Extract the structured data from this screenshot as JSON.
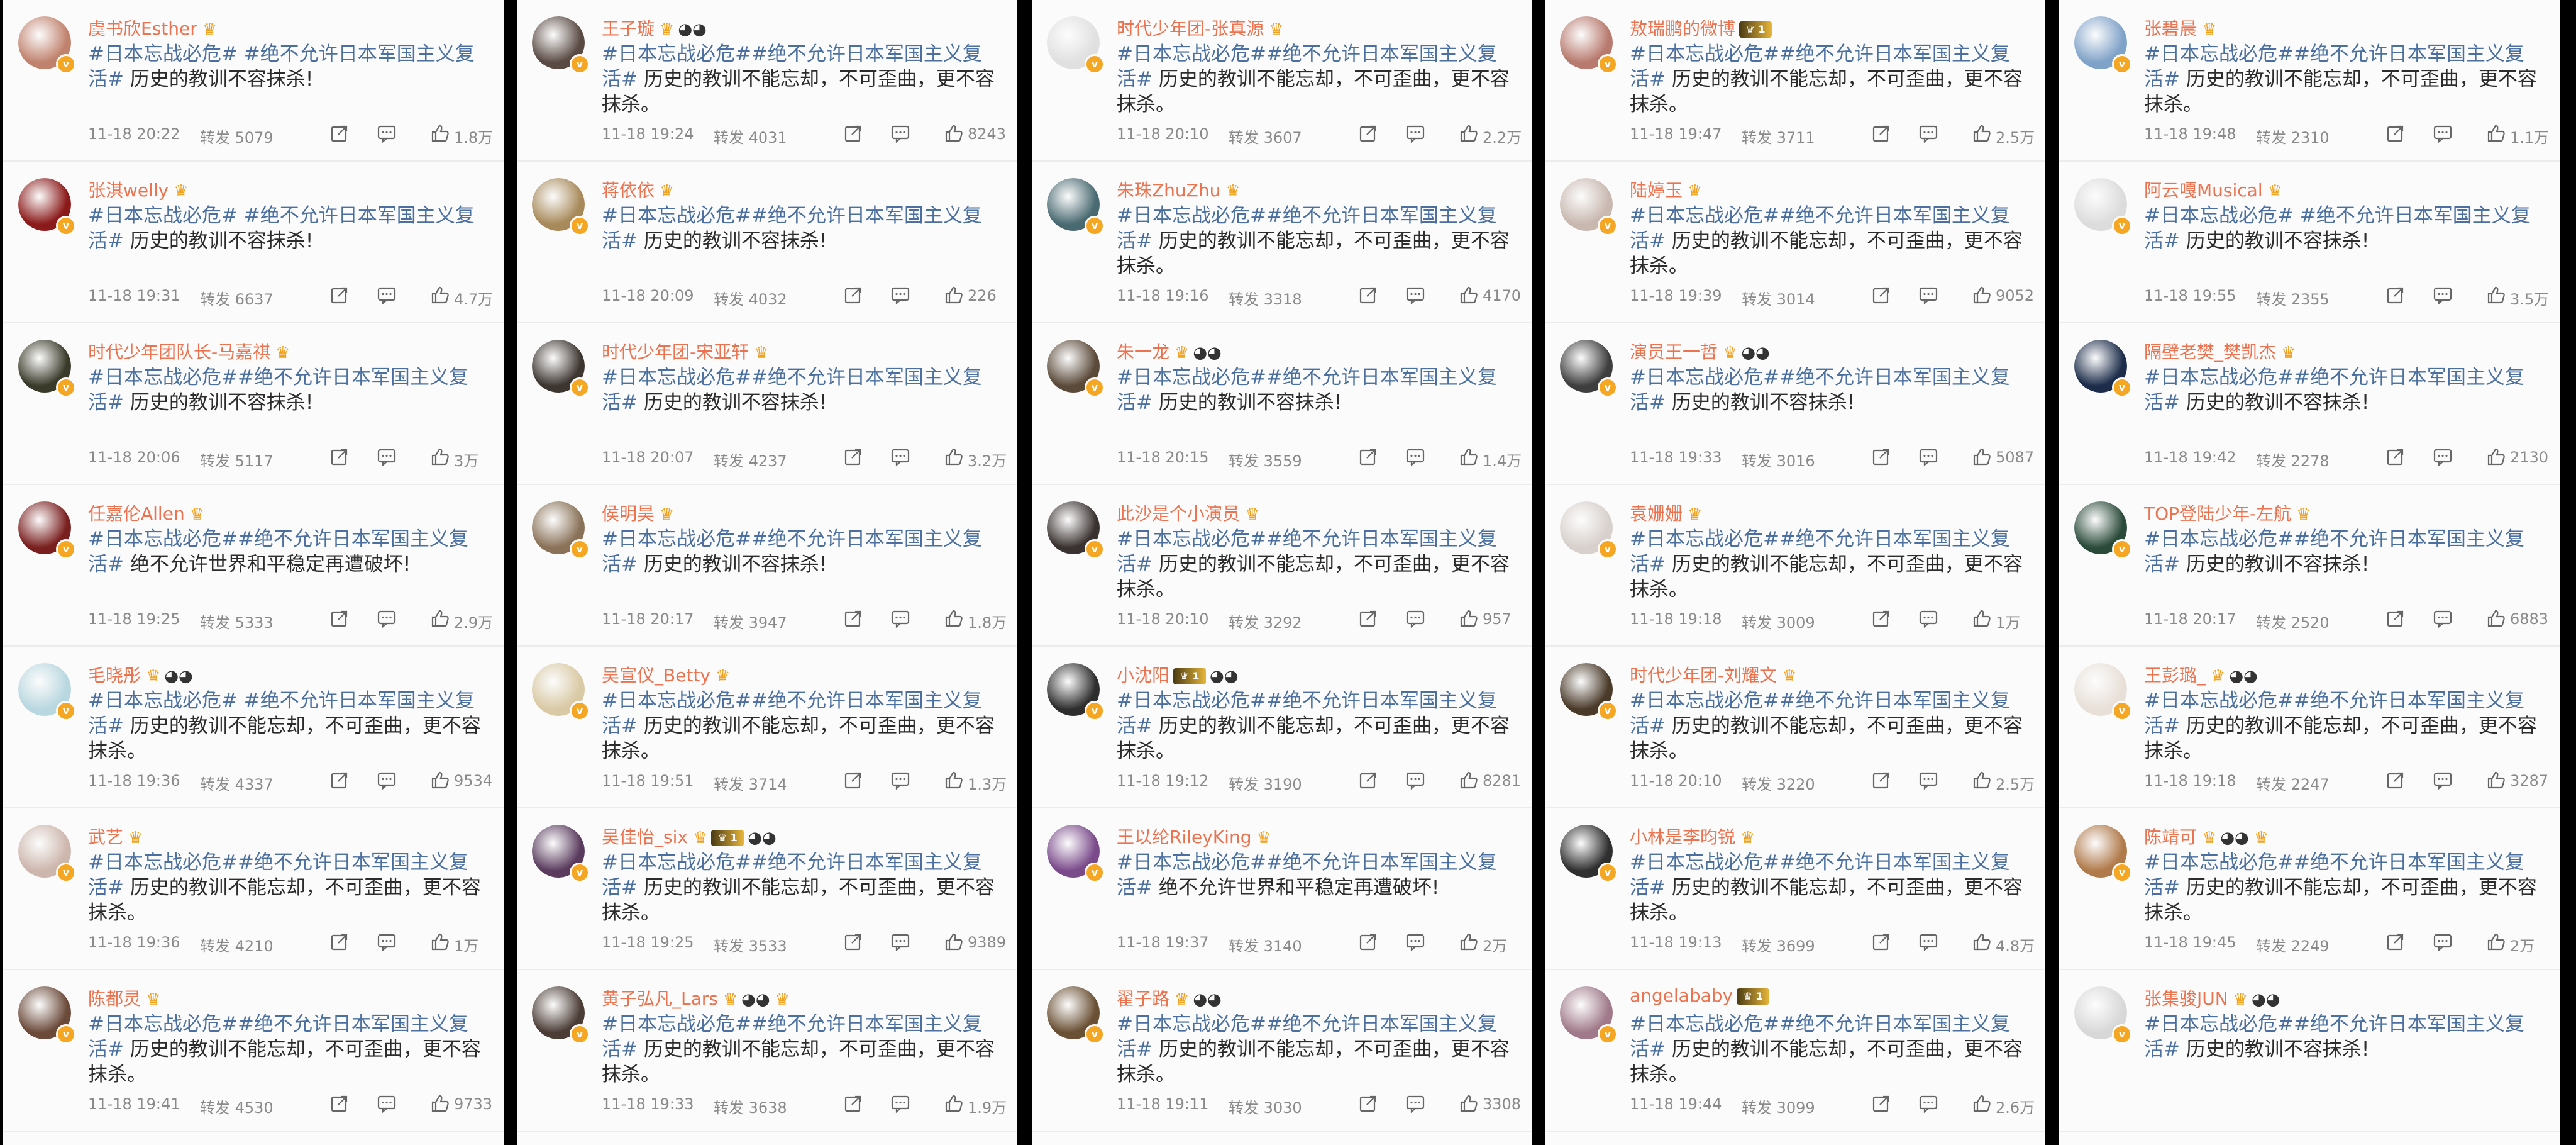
{
  "columns": [
    {
      "posts": [
        {
          "name": "虞书欣Esther",
          "badges": [
            "crown"
          ],
          "tags": "#日本忘战必危# #绝不允许日本军国主义复活#",
          "text": " 历史的教训不容抹杀!",
          "time": "11-18 20:22",
          "repost": "转发 5079",
          "likes": "1.8万",
          "av": "#c0826d"
        },
        {
          "name": "张淇welly",
          "badges": [
            "crown"
          ],
          "tags": "#日本忘战必危# #绝不允许日本军国主义复活#",
          "text": " 历史的教训不容抹杀!",
          "time": "11-18 19:31",
          "repost": "转发 6637",
          "likes": "4.7万",
          "av": "#8b1a1a"
        },
        {
          "name": "时代少年团队长-马嘉祺",
          "badges": [
            "crown"
          ],
          "tags": "#日本忘战必危##绝不允许日本军国主义复活#",
          "text": " 历史的教训不容抹杀!",
          "time": "11-18 20:06",
          "repost": "转发 5117",
          "likes": "3万",
          "av": "#3a3a2a"
        },
        {
          "name": "任嘉伦Allen",
          "badges": [
            "crown"
          ],
          "tags": "#日本忘战必危##绝不允许日本军国主义复活#",
          "text": " 绝不允许世界和平稳定再遭破坏!",
          "time": "11-18 19:25",
          "repost": "转发 5333",
          "likes": "2.9万",
          "av": "#7a1f1f"
        },
        {
          "name": "毛晓彤",
          "badges": [
            "crown",
            "panda"
          ],
          "tags": "#日本忘战必危# #绝不允许日本军国主义复活#",
          "text": " 历史的教训不能忘却，不可歪曲，更不容抹杀。",
          "time": "11-18 19:36",
          "repost": "转发 4337",
          "likes": "9534",
          "av": "#b9d7e0"
        },
        {
          "name": "武艺",
          "badges": [
            "crown"
          ],
          "tags": "#日本忘战必危##绝不允许日本军国主义复活#",
          "text": " 历史的教训不能忘却，不可歪曲，更不容抹杀。",
          "time": "11-18 19:36",
          "repost": "转发 4210",
          "likes": "1万",
          "av": "#cdb6ad"
        },
        {
          "name": "陈都灵",
          "badges": [
            "crown"
          ],
          "tags": "#日本忘战必危##绝不允许日本军国主义复活#",
          "text": " 历史的教训不能忘却，不可歪曲，更不容抹杀。",
          "time": "11-18 19:41",
          "repost": "转发 4530",
          "likes": "9733",
          "av": "#6b4a3a"
        }
      ]
    },
    {
      "posts": [
        {
          "name": "王子璇",
          "badges": [
            "crown",
            "panda"
          ],
          "tags": "#日本忘战必危##绝不允许日本军国主义复活#",
          "text": " 历史的教训不能忘却，不可歪曲，更不容抹杀。",
          "time": "11-18 19:24",
          "repost": "转发 4031",
          "likes": "8243",
          "av": "#5a4a44"
        },
        {
          "name": "蒋依依",
          "badges": [
            "crown"
          ],
          "tags": "#日本忘战必危##绝不允许日本军国主义复活#",
          "text": " 历史的教训不容抹杀!",
          "time": "11-18 20:09",
          "repost": "转发 4032",
          "likes": "226",
          "av": "#a88a5a"
        },
        {
          "name": "时代少年团-宋亚轩",
          "badges": [
            "crown"
          ],
          "tags": "#日本忘战必危##绝不允许日本军国主义复活#",
          "text": " 历史的教训不容抹杀!",
          "time": "11-18 20:07",
          "repost": "转发 4237",
          "likes": "3.2万",
          "av": "#3d3530"
        },
        {
          "name": "侯明昊",
          "badges": [
            "crown"
          ],
          "tags": "#日本忘战必危##绝不允许日本军国主义复活#",
          "text": " 历史的教训不容抹杀!",
          "time": "11-18 20:17",
          "repost": "转发 3947",
          "likes": "1.8万",
          "av": "#8a7258"
        },
        {
          "name": "吴宣仪_Betty",
          "badges": [
            "crown"
          ],
          "tags": "#日本忘战必危##绝不允许日本军国主义复活#",
          "text": " 历史的教训不能忘却，不可歪曲，更不容抹杀。",
          "time": "11-18 19:51",
          "repost": "转发 3714",
          "likes": "1.3万",
          "av": "#d9c9a4"
        },
        {
          "name": "吴佳怡_six",
          "badges": [
            "crown",
            "vip",
            "panda"
          ],
          "tags": "#日本忘战必危##绝不允许日本军国主义复活#",
          "text": " 历史的教训不能忘却，不可歪曲，更不容抹杀。",
          "time": "11-18 19:25",
          "repost": "转发 3533",
          "likes": "9389",
          "av": "#5a3b5e"
        },
        {
          "name": "黄子弘凡_Lars",
          "badges": [
            "crown",
            "panda",
            "crown"
          ],
          "tags": "#日本忘战必危##绝不允许日本军国主义复活#",
          "text": " 历史的教训不能忘却，不可歪曲，更不容抹杀。",
          "time": "11-18 19:33",
          "repost": "转发 3638",
          "likes": "1.9万",
          "av": "#4b3c36"
        }
      ]
    },
    {
      "posts": [
        {
          "name": "时代少年团-张真源",
          "badges": [
            "crown"
          ],
          "tags": "#日本忘战必危##绝不允许日本军国主义复活#",
          "text": " 历史的教训不能忘却，不可歪曲，更不容抹杀。",
          "time": "11-18 20:10",
          "repost": "转发 3607",
          "likes": "2.2万",
          "av": "#e0e0e0"
        },
        {
          "name": "朱珠ZhuZhu",
          "badges": [
            "crown"
          ],
          "tags": "#日本忘战必危##绝不允许日本军国主义复活#",
          "text": " 历史的教训不能忘却，不可歪曲，更不容抹杀。",
          "time": "11-18 19:16",
          "repost": "转发 3318",
          "likes": "4170",
          "av": "#4a6a72"
        },
        {
          "name": "朱一龙",
          "badges": [
            "crown",
            "panda"
          ],
          "tags": "#日本忘战必危##绝不允许日本军国主义复活#",
          "text": " 历史的教训不容抹杀!",
          "time": "11-18 20:15",
          "repost": "转发 3559",
          "likes": "1.4万",
          "av": "#5b4a3a"
        },
        {
          "name": "此沙是个小演员",
          "badges": [
            "crown"
          ],
          "tags": "#日本忘战必危##绝不允许日本军国主义复活#",
          "text": " 历史的教训不能忘却，不可歪曲，更不容抹杀。",
          "time": "11-18 20:10",
          "repost": "转发 3292",
          "likes": "957",
          "av": "#3a3230"
        },
        {
          "name": "小沈阳",
          "badges": [
            "vip",
            "panda"
          ],
          "tags": "#日本忘战必危##绝不允许日本军国主义复活#",
          "text": " 历史的教训不能忘却，不可歪曲，更不容抹杀。",
          "time": "11-18 19:12",
          "repost": "转发 3190",
          "likes": "8281",
          "av": "#2e2e2e"
        },
        {
          "name": "王以纶RileyKing",
          "badges": [
            "crown"
          ],
          "tags": "#日本忘战必危##绝不允许日本军国主义复活#",
          "text": " 绝不允许世界和平稳定再遭破坏!",
          "time": "11-18 19:37",
          "repost": "转发 3140",
          "likes": "2万",
          "av": "#7a4a8a"
        },
        {
          "name": "翟子路",
          "badges": [
            "crown",
            "panda"
          ],
          "tags": "#日本忘战必危##绝不允许日本军国主义复活#",
          "text": " 历史的教训不能忘却，不可歪曲，更不容抹杀。",
          "time": "11-18 19:11",
          "repost": "转发 3030",
          "likes": "3308",
          "av": "#6a5034"
        }
      ]
    },
    {
      "posts": [
        {
          "name": "敖瑞鹏的微博",
          "badges": [
            "vip"
          ],
          "tags": "#日本忘战必危##绝不允许日本军国主义复活#",
          "text": " 历史的教训不能忘却，不可歪曲，更不容抹杀。",
          "time": "11-18 19:47",
          "repost": "转发 3711",
          "likes": "2.5万",
          "av": "#b87a6e"
        },
        {
          "name": "陆婷玉",
          "badges": [
            "crown"
          ],
          "tags": "#日本忘战必危##绝不允许日本军国主义复活#",
          "text": " 历史的教训不能忘却，不可歪曲，更不容抹杀。",
          "time": "11-18 19:39",
          "repost": "转发 3014",
          "likes": "9052",
          "av": "#c9b8b0"
        },
        {
          "name": "演员王一哲",
          "badges": [
            "crown",
            "panda"
          ],
          "tags": "#日本忘战必危##绝不允许日本军国主义复活#",
          "text": " 历史的教训不容抹杀!",
          "time": "11-18 19:33",
          "repost": "转发 3016",
          "likes": "5087",
          "av": "#3e3e3e"
        },
        {
          "name": "袁姗姗",
          "badges": [
            "crown"
          ],
          "tags": "#日本忘战必危##绝不允许日本军国主义复活#",
          "text": " 历史的教训不能忘却，不可歪曲，更不容抹杀。",
          "time": "11-18 19:18",
          "repost": "转发 3009",
          "likes": "1万",
          "av": "#d8d0cc"
        },
        {
          "name": "时代少年团-刘耀文",
          "badges": [
            "crown"
          ],
          "tags": "#日本忘战必危##绝不允许日本军国主义复活#",
          "text": " 历史的教训不能忘却，不可歪曲，更不容抹杀。",
          "time": "11-18 20:10",
          "repost": "转发 3220",
          "likes": "2.5万",
          "av": "#4a3a2a"
        },
        {
          "name": "小林是李昀锐",
          "badges": [
            "crown"
          ],
          "tags": "#日本忘战必危##绝不允许日本军国主义复活#",
          "text": " 历史的教训不能忘却，不可歪曲，更不容抹杀。",
          "time": "11-18 19:13",
          "repost": "转发 3699",
          "likes": "4.8万",
          "av": "#2f2f2f"
        },
        {
          "name": "angelababy",
          "badges": [
            "vip"
          ],
          "tags": "#日本忘战必危##绝不允许日本军国主义复活#",
          "text": " 历史的教训不能忘却，不可歪曲，更不容抹杀。",
          "time": "11-18 19:44",
          "repost": "转发 3099",
          "likes": "2.6万",
          "av": "#a07a8a"
        }
      ]
    },
    {
      "posts": [
        {
          "name": "张碧晨",
          "badges": [
            "crown"
          ],
          "tags": "#日本忘战必危##绝不允许日本军国主义复活#",
          "text": " 历史的教训不能忘却，不可歪曲，更不容抹杀。",
          "time": "11-18 19:48",
          "repost": "转发 2310",
          "likes": "1.1万",
          "av": "#7fa2c8"
        },
        {
          "name": "阿云嘎Musical",
          "badges": [
            "crown"
          ],
          "tags": "#日本忘战必危# #绝不允许日本军国主义复活#",
          "text": " 历史的教训不容抹杀!",
          "time": "11-18 19:55",
          "repost": "转发 2355",
          "likes": "3.5万",
          "av": "#dcdcdc"
        },
        {
          "name": "隔壁老樊_樊凯杰",
          "badges": [
            "crown"
          ],
          "tags": "#日本忘战必危##绝不允许日本军国主义复活#",
          "text": " 历史的教训不容抹杀!",
          "time": "11-18 19:42",
          "repost": "转发 2278",
          "likes": "2130",
          "av": "#1c2c4a"
        },
        {
          "name": "TOP登陆少年-左航",
          "badges": [
            "crown"
          ],
          "tags": "#日本忘战必危##绝不允许日本军国主义复活#",
          "text": " 历史的教训不容抹杀!",
          "time": "11-18 20:17",
          "repost": "转发 2520",
          "likes": "6883",
          "av": "#2a4a3a"
        },
        {
          "name": "王彭璐_",
          "badges": [
            "crown",
            "panda"
          ],
          "tags": "#日本忘战必危##绝不允许日本军国主义复活#",
          "text": " 历史的教训不能忘却，不可歪曲，更不容抹杀。",
          "time": "11-18 19:18",
          "repost": "转发 2247",
          "likes": "3287",
          "av": "#e8e0d8"
        },
        {
          "name": "陈靖可",
          "badges": [
            "crown",
            "panda",
            "crown"
          ],
          "tags": "#日本忘战必危##绝不允许日本军国主义复活#",
          "text": " 历史的教训不能忘却，不可歪曲，更不容抹杀。",
          "time": "11-18 19:45",
          "repost": "转发 2249",
          "likes": "2万",
          "av": "#b07a4a"
        },
        {
          "name": "张集骏JUN",
          "badges": [
            "crown",
            "panda"
          ],
          "tags": "#日本忘战必危##绝不允许日本军国主义复活#",
          "text": " 历史的教训不容抹杀!",
          "time": "",
          "repost": "",
          "likes": "",
          "av": "#d8d8d8"
        }
      ]
    }
  ],
  "icons": {
    "share": "share-icon",
    "comment": "comment-icon",
    "like": "thumbs-up-icon",
    "verified": "verified-badge-icon",
    "crown": "crown-badge-icon",
    "panda": "panda-badge-icon",
    "vip": "vip-badge-icon"
  },
  "colors": {
    "name": "#eb7350",
    "tag": "#4a6fa0",
    "text": "#2c2c2c",
    "meta": "#8a8a8a",
    "background": "#000000"
  }
}
